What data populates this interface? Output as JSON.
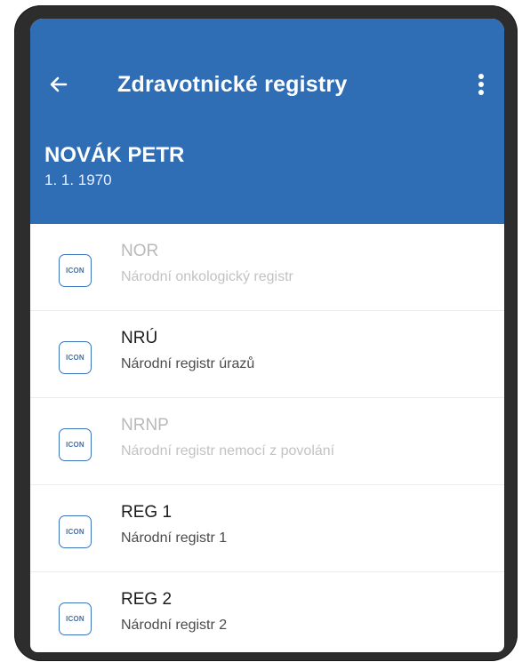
{
  "header": {
    "title": "Zdravotnické registry",
    "back_icon": "arrow-left-icon",
    "menu_icon": "more-vertical-icon",
    "patient_name": "NOVÁK PETR",
    "patient_dob": "1. 1. 1970",
    "background_color": "#2f6db5"
  },
  "registries": [
    {
      "icon_text": "ICON",
      "code": "NOR",
      "name": "Národní onkologický registr",
      "enabled": false
    },
    {
      "icon_text": "ICON",
      "code": "NRÚ",
      "name": "Národní registr úrazů",
      "enabled": true
    },
    {
      "icon_text": "ICON",
      "code": "NRNP",
      "name": "Národní registr nemocí z povolání",
      "enabled": false
    },
    {
      "icon_text": "ICON",
      "code": "REG 1",
      "name": "Národní registr 1",
      "enabled": true
    },
    {
      "icon_text": "ICON",
      "code": "REG 2",
      "name": "Národní registr 2",
      "enabled": true
    }
  ]
}
